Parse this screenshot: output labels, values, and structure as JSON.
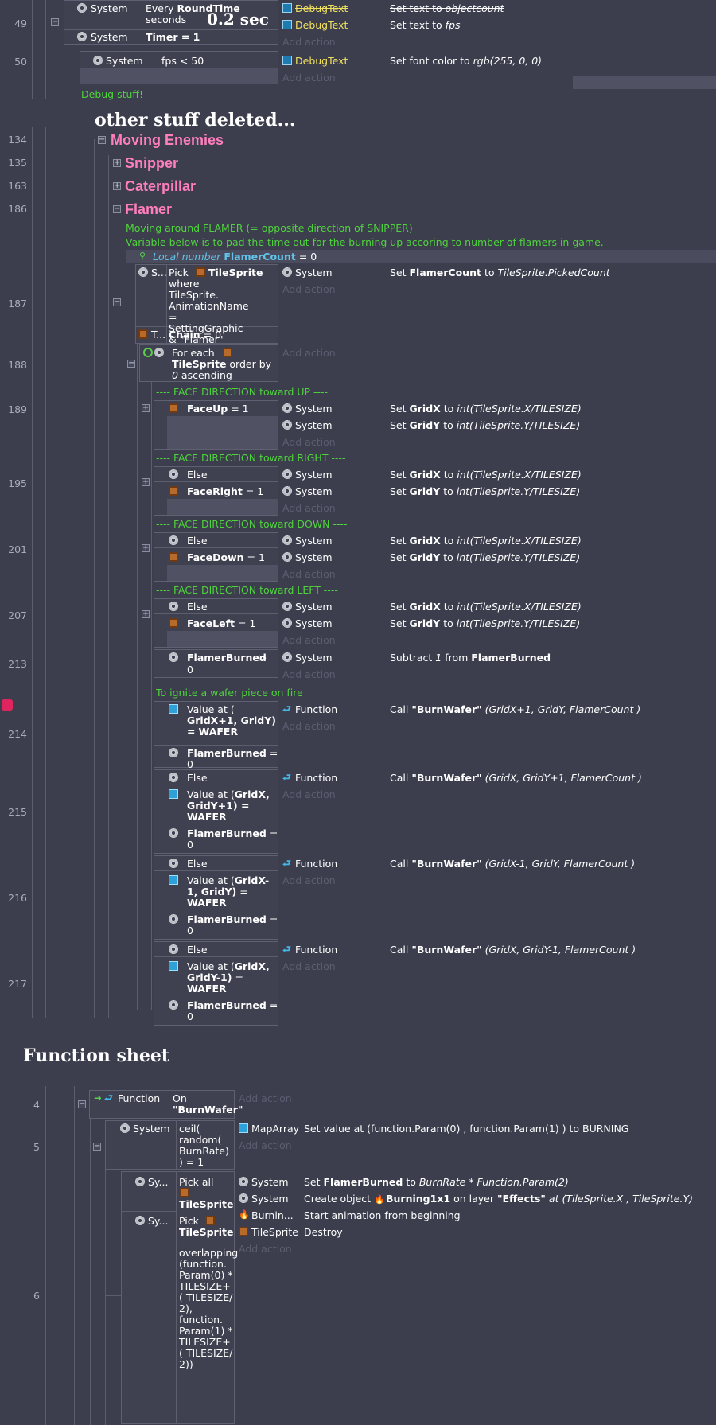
{
  "top_block": {
    "line49": "49",
    "line50": "50",
    "ev49_system1": "System",
    "ev49_every": "Every",
    "ev49_roundtime": "RoundTime",
    "ev49_seconds": "seconds",
    "ev49_overlay": "0.2 sec",
    "ev49_system2": "System",
    "ev49_timer": "Timer = 1",
    "ev49_act1_obj": "DebugText",
    "ev49_act1_text": "Set text to ",
    "ev49_act1_val": "objectcount",
    "ev49_act2_obj": "DebugText",
    "ev49_act2_text": "Set text to ",
    "ev49_act2_val": "fps",
    "add_action": "Add action",
    "ev50_system": "System",
    "ev50_cond": "fps < 50",
    "ev50_act_obj": "DebugText",
    "ev50_act_text": "Set font color to ",
    "ev50_act_val": "rgb(255, 0, 0)",
    "debug_comment": "Debug stuff!"
  },
  "note_deleted": "other stuff deleted...",
  "groups": {
    "l134": "134",
    "moving": "Moving Enemies",
    "l135": "135",
    "snipper": "Snipper",
    "l163": "163",
    "caterpillar": "Caterpillar",
    "l186": "186",
    "flamer": "Flamer"
  },
  "flamer": {
    "comment1": "Moving around FLAMER (= opposite direction of SNIPPER)",
    "comment2": "Variable below is to pad the time out for the burning up accoring to number of flamers in game.",
    "localvar_kw": "Local number",
    "localvar_name": "FlamerCount",
    "localvar_rest": " = 0",
    "l187": "187",
    "e187_sys": "S...",
    "e187_pick": "Pick",
    "e187_tilesprite": "TileSprite",
    "e187_cond": "where TileSprite. AnimationName = SettingGraphic & \"Flamer\"",
    "e187_t": "T...",
    "e187_chain": "Chain",
    "e187_chain_rest": " = 0",
    "e187_act_obj": "System",
    "e187_act_set": "Set ",
    "e187_act_var": "FlamerCount",
    "e187_act_to": " to ",
    "e187_act_val": "TileSprite.PickedCount",
    "l188": "188",
    "e188_foreach": "For each",
    "e188_tilesprite": "TileSprite",
    "e188_order": " order by",
    "e188_zero": "0",
    "e188_asc": " ascending",
    "c_up": "---- FACE DIRECTION toward UP ----",
    "l189": "189",
    "e189_cond": "FaceUp",
    "e189_cond_rest": " = 1",
    "c_right": "---- FACE DIRECTION toward RIGHT ----",
    "l195": "195",
    "e195_else": "Else",
    "e195_cond": "FaceRight",
    "e195_cond_rest": " = 1",
    "c_down": "---- FACE DIRECTION toward DOWN ----",
    "l201": "201",
    "e201_else": "Else",
    "e201_cond": "FaceDown",
    "e201_cond_rest": " = 1",
    "c_left": "---- FACE DIRECTION toward LEFT ----",
    "l207": "207",
    "e207_else": "Else",
    "e207_cond": "FaceLeft",
    "e207_cond_rest": " = 1",
    "system": "System",
    "set": "Set ",
    "gridx": "GridX",
    "gridy": "GridY",
    "to": " to ",
    "gx_val": "int(TileSprite.X/TILESIZE)",
    "gy_val": "int(TileSprite.Y/TILESIZE)",
    "l213": "213",
    "e213_cond": "FlamerBurned",
    "e213_cond_rest": " > 0",
    "e213_act_sub": "Subtract ",
    "e213_act_one": "1",
    "e213_act_from": " from ",
    "e213_act_var": "FlamerBurned",
    "c_ignite": "To ignite a wafer piece on fire",
    "l214": "214",
    "l215": "215",
    "l216": "216",
    "l217": "217",
    "else": "Else",
    "function": "Function",
    "call": "Call ",
    "burnwafer": "\"BurnWafer\"",
    "fb_cond": "FlamerBurned",
    "fb_rest": " = 0",
    "v214_a": "Value at (",
    "v214_b": "GridX+1, GridY)",
    "v214_c": " = WAFER",
    "a214": " (GridX+1, GridY, FlamerCount )",
    "v215_a": "Value at (",
    "v215_b": "GridX, GridY+1)",
    "v215_c": " = WAFER",
    "a215": " (GridX, GridY+1, FlamerCount )",
    "v216_a": "Value at (",
    "v216_b": "GridX-1, GridY)",
    "v216_c": " = WAFER",
    "a216": " (GridX-1, GridY, FlamerCount )",
    "v217_a": "Value at (",
    "v217_b": "GridX, GridY-1)",
    "v217_c": " = WAFER",
    "a217": " (GridX, GridY-1, FlamerCount )"
  },
  "function_sheet": {
    "title": "Function sheet",
    "l4": "4",
    "l5": "5",
    "l6": "6",
    "e4_obj": "Function",
    "e4_on": "On",
    "e4_name": "\"BurnWafer\"",
    "add_action": "Add action",
    "e5_obj": "System",
    "e5_cond": "ceil( random( BurnRate) ) = 1",
    "e5_act_obj": "MapArray",
    "e5_act": "Set value at (function.Param(0) , function.Param(1) ) to BURNING",
    "e6_sys1": "Sy...",
    "e6_pickall": "Pick all",
    "e6_tilesprite": "TileSprite",
    "e6_sys2": "Sy...",
    "e6_pick": "Pick",
    "e6_tilesprite2": "TileSprite",
    "e6_overlap": "overlapping (function. Param(0) * TILESIZE+ ( TILESIZE/ 2), function. Param(1) * TILESIZE+ ( TILESIZE/ 2))",
    "e6_a1_obj": "System",
    "e6_a1_set": "Set ",
    "e6_a1_var": "FlamerBurned",
    "e6_a1_to": " to ",
    "e6_a1_val": "BurnRate * Function.Param(2)",
    "e6_a2_obj": "System",
    "e6_a2_text": "Create object ",
    "e6_a2_name": "Burning1x1",
    "e6_a2_layer": " on layer ",
    "e6_a2_effects": "\"Effects\"",
    "e6_a2_at": " at (TileSprite.X , TileSprite.Y)",
    "e6_a3_obj": "Burnin...",
    "e6_a3_text": "Start animation from beginning",
    "e6_a4_obj": "TileSprite",
    "e6_a4_text": "Destroy"
  }
}
